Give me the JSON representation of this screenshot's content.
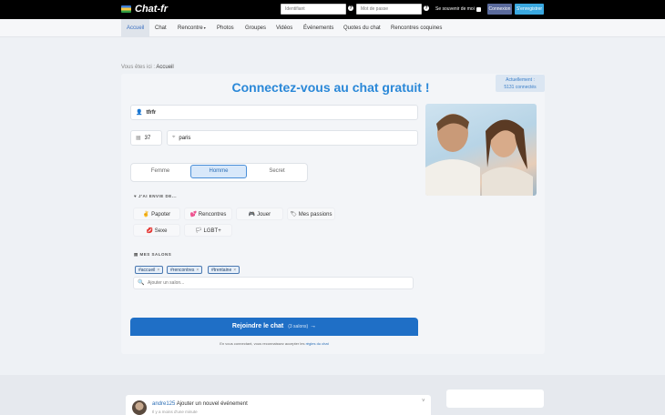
{
  "topbar": {
    "logo_text": "Chat-fr",
    "username_placeholder": "Identifiant",
    "password_placeholder": "Mot de passe",
    "help_glyph": "?",
    "remember_label": "Se souvenir de moi",
    "connexion_label": "Connexion",
    "register_label": "S'enregistrer"
  },
  "nav": {
    "items": [
      "Accueil",
      "Chat",
      "Rencontre",
      "Photos",
      "Groupes",
      "Vidéos",
      "Événements",
      "Quotes du chat",
      "Rencontres coquines"
    ],
    "caret": "▾"
  },
  "breadcrumb": {
    "prefix": "Vous êtes ici :",
    "current": "Accueil"
  },
  "online": {
    "line1": "Actuellement :",
    "line2": "5131 connectés"
  },
  "main": {
    "headline": "Connectez-vous au chat gratuit !",
    "pseudo_value": "tfrfr",
    "age_value": "37",
    "city_value": "paris",
    "gender": {
      "options": [
        "Femme",
        "Homme",
        "Secret"
      ],
      "selected": "Homme"
    },
    "envie_label": "J'AI ENVIE DE...",
    "envie_items": [
      {
        "icon": "✌",
        "label": "Papoter"
      },
      {
        "icon": "💕",
        "label": "Rencontres"
      },
      {
        "icon": "🎮",
        "label": "Jouer"
      },
      {
        "icon": "🏷",
        "label": "Mes passions"
      },
      {
        "icon": "💋",
        "label": "Sexe"
      },
      {
        "icon": "🏳",
        "label": "LGBT+"
      }
    ],
    "salons_label": "MES SALONS",
    "salon_tags": [
      "#accueil",
      "#rencontres",
      "#trentaine"
    ],
    "tag_remove": "×",
    "salon_placeholder": "Ajouter un salon...",
    "join_label": "Rejoindre le chat",
    "join_sub": "(3 salons)",
    "join_arrow": "→",
    "terms_text": "En vous connectant, vous reconnaissez accepter les",
    "terms_link": "règles du chat"
  },
  "feed": {
    "user": "andre125",
    "action": "Ajouter un nouvel événement",
    "time": "Il y a moins d'une minute",
    "chevron": "˅"
  },
  "icons": {
    "user_icon": "👤",
    "age_icon": "▦",
    "location_icon": "⌖",
    "heart_icon": "♥",
    "salons_icon": "▤",
    "search_icon": "🔍"
  }
}
